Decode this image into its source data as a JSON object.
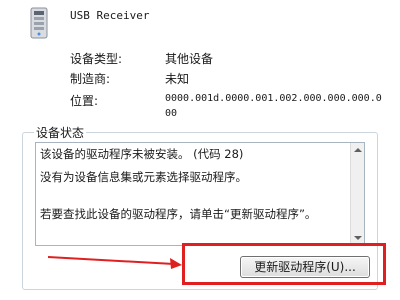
{
  "device": {
    "icon": "usb-device-icon",
    "name": "USB Receiver"
  },
  "properties": [
    {
      "label": "设备类型:",
      "value": "其他设备"
    },
    {
      "label": "制造商:",
      "value": "未知"
    },
    {
      "label": "位置:",
      "value_lines": [
        "0000.001d.0000.001.002.000.000.000.0",
        "00"
      ]
    }
  ],
  "status": {
    "title": "设备状态",
    "lines": [
      "该设备的驱动程序未被安装。 (代码 28)",
      "没有为设备信息集或元素选择驱动程序。",
      "若要查找此设备的驱动程序，请单击“更新驱动程序”。"
    ]
  },
  "update_button": {
    "label": "更新驱动程序(U)..."
  },
  "annotation": {
    "color": "#e02020"
  }
}
